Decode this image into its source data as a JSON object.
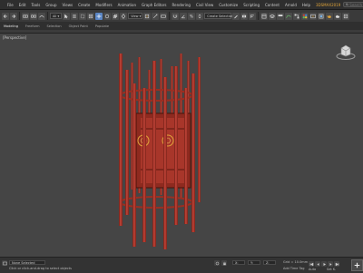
{
  "menu": {
    "items": [
      "File",
      "Edit",
      "Tools",
      "Group",
      "Views",
      "Create",
      "Modifiers",
      "Animation",
      "Graph Editors",
      "Rendering",
      "Civil View",
      "Customize",
      "Scripting",
      "Content",
      "Arnold",
      "Help",
      "3DSMAX2019"
    ],
    "search_placeholder": "Search"
  },
  "toolbar": {
    "view_dropdown": "View",
    "selection_set": "Create Selection Set"
  },
  "ribbon": {
    "tabs": [
      "Modeling",
      "Freeform",
      "Selection",
      "Object Paint",
      "Populate"
    ]
  },
  "viewport": {
    "label": "[Perspective]",
    "model_color": "#b23a2c",
    "background": "#454545"
  },
  "status": {
    "selection": "None Selected",
    "prompt": "Click or click-and-drag to select objects",
    "grid": "Grid = 10.0mm",
    "add_time_tag": "Add Time Tag",
    "auto_key": "Auto",
    "set_key": "Set K."
  }
}
